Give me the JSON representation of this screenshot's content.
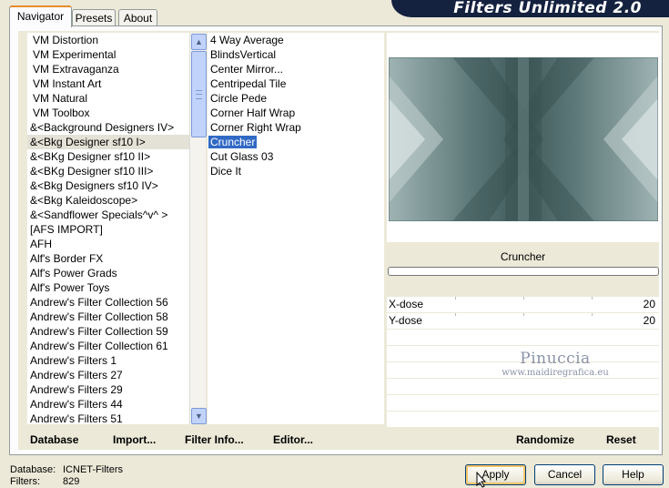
{
  "window": {
    "title": "Filters Unlimited 2.0"
  },
  "tabs": [
    {
      "label": "Navigator",
      "active": true
    },
    {
      "label": "Presets",
      "active": false
    },
    {
      "label": "About",
      "active": false
    }
  ],
  "categories": [
    "VM Distortion",
    "VM Experimental",
    "VM Extravaganza",
    "VM Instant Art",
    "VM Natural",
    "VM Toolbox",
    "&<Background Designers IV>",
    "&<Bkg Designer sf10 I>",
    "&<BKg Designer sf10 II>",
    "&<BKg Designer sf10 III>",
    "&<Bkg Designers sf10 IV>",
    "&<Bkg Kaleidoscope>",
    "&<Sandflower Specials^v^ >",
    "[AFS IMPORT]",
    "AFH",
    "Alf's Border FX",
    "Alf's Power Grads",
    "Alf's Power Toys",
    "Andrew's Filter Collection 56",
    "Andrew's Filter Collection 58",
    "Andrew's Filter Collection 59",
    "Andrew's Filter Collection 61",
    "Andrew's Filters 1",
    "Andrew's Filters 27",
    "Andrew's Filters 29",
    "Andrew's Filters 44",
    "Andrew's Filters 51"
  ],
  "selected_category_index": 7,
  "filters": [
    "4 Way Average",
    "BlindsVertical",
    "Center Mirror...",
    "Centripedal Tile",
    "Circle Pede",
    "Corner Half Wrap",
    "Corner Right Wrap",
    "Cruncher",
    "Cut Glass 03",
    "Dice It"
  ],
  "selected_filter_index": 7,
  "preview": {
    "filter_name": "Cruncher",
    "progress": 0
  },
  "params": [
    {
      "label": "X-dose",
      "value": "20"
    },
    {
      "label": "Y-dose",
      "value": "20"
    }
  ],
  "watermark": {
    "line1": "Pinuccia",
    "line2": "www.maidiregrafica.eu"
  },
  "panel_buttons": {
    "database": "Database",
    "import": "Import...",
    "filter_info": "Filter Info...",
    "editor": "Editor...",
    "randomize": "Randomize",
    "reset": "Reset"
  },
  "footer": {
    "database_label": "Database:",
    "database_value": "ICNET-Filters",
    "filters_label": "Filters:",
    "filters_value": "829"
  },
  "dialog_buttons": {
    "apply": "Apply",
    "cancel": "Cancel",
    "help": "Help"
  },
  "colors": {
    "banner": "#14213f",
    "selection": "#316ac5",
    "preview_base": "#6f8888"
  },
  "icons": {
    "scroll_up": "chevron-up-icon",
    "scroll_down": "chevron-down-icon"
  }
}
